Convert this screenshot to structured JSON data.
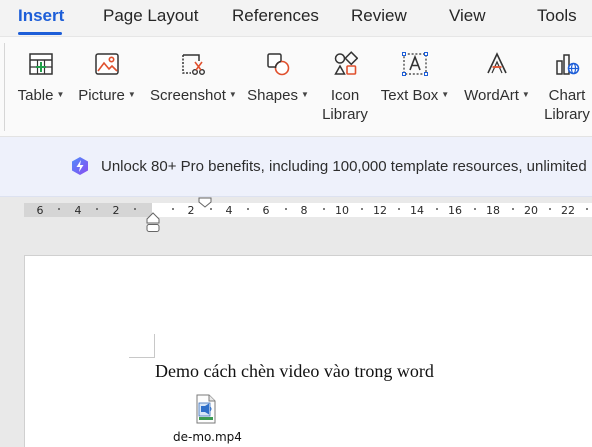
{
  "tabs": [
    {
      "label": "Insert",
      "active": true
    },
    {
      "label": "Page Layout"
    },
    {
      "label": "References"
    },
    {
      "label": "Review"
    },
    {
      "label": "View"
    },
    {
      "label": "Tools"
    }
  ],
  "ribbon": {
    "table": "Table",
    "picture": "Picture",
    "screenshot": "Screenshot",
    "shapes": "Shapes",
    "icon_library_1": "Icon",
    "icon_library_2": "Library",
    "text_box": "Text Box",
    "wordart": "WordArt",
    "chart_library_1": "Chart",
    "chart_library_2": "Library"
  },
  "banner": {
    "text": "Unlock 80+ Pro benefits, including 100,000 template resources, unlimited P"
  },
  "ruler": {
    "labels": [
      "6",
      "4",
      "2",
      "2",
      "4",
      "6",
      "8",
      "10",
      "12",
      "14",
      "16",
      "18",
      "20",
      "22"
    ]
  },
  "document": {
    "text": "Demo cách chèn video vào trong word",
    "attachment_name": "de-mo.mp4"
  },
  "colors": {
    "accent": "#1d5ed8",
    "banner_bg": "#eef1fb",
    "page_bg": "#e9e9e9"
  }
}
